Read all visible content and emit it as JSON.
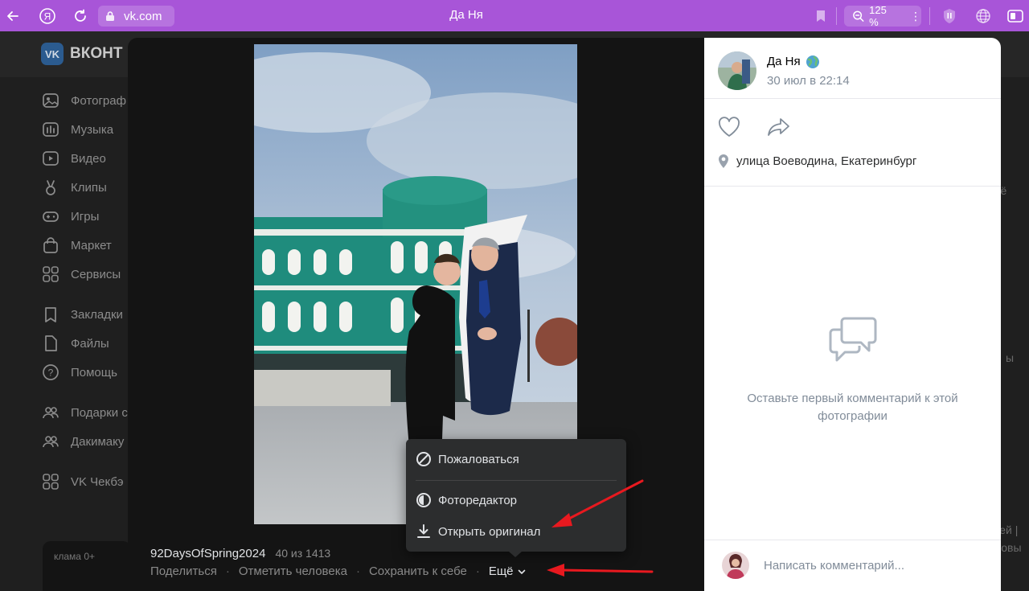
{
  "browser": {
    "url": "vk.com",
    "tab_title": "Да Ня",
    "zoom": "125 %"
  },
  "vk": {
    "logo_text": "ВКОНТ",
    "sidebar": [
      {
        "label": "Фотограф",
        "icon": "photo-icon"
      },
      {
        "label": "Музыка",
        "icon": "music-icon"
      },
      {
        "label": "Видео",
        "icon": "video-icon"
      },
      {
        "label": "Клипы",
        "icon": "clips-icon"
      },
      {
        "label": "Игры",
        "icon": "games-icon"
      },
      {
        "label": "Маркет",
        "icon": "market-icon"
      },
      {
        "label": "Сервисы",
        "icon": "services-icon"
      },
      {
        "label": "Закладки",
        "icon": "bookmark-icon"
      },
      {
        "label": "Файлы",
        "icon": "file-icon"
      },
      {
        "label": "Помощь",
        "icon": "help-icon"
      },
      {
        "label": "Подарки с",
        "icon": "group-icon"
      },
      {
        "label": "Дакимаку",
        "icon": "group-icon"
      },
      {
        "label": "VK Чекбэ",
        "icon": "services-icon"
      }
    ],
    "ad_label": "клама 0+",
    "right_peek": [
      "щё",
      "ы",
      "тей |",
      "товы"
    ]
  },
  "viewer": {
    "caption_title": "92DaysOfSpring2024",
    "counter": "40 из 1413",
    "actions": {
      "share": "Поделиться",
      "tag": "Отметить человека",
      "save": "Сохранить к себе",
      "more": "Ещё"
    },
    "menu": {
      "report": "Пожаловаться",
      "editor": "Фоторедактор",
      "open_original": "Открыть оригинал"
    }
  },
  "panel": {
    "author_name": "Да Ня",
    "date": "30 июл в 22:14",
    "location": "улица Воеводина, Екатеринбург",
    "empty_comments": "Оставьте первый комментарий к этой фотографии",
    "comment_placeholder": "Написать комментарий..."
  },
  "colors": {
    "browser_accent": "#a855d8",
    "annotation_red": "#e8191f"
  }
}
